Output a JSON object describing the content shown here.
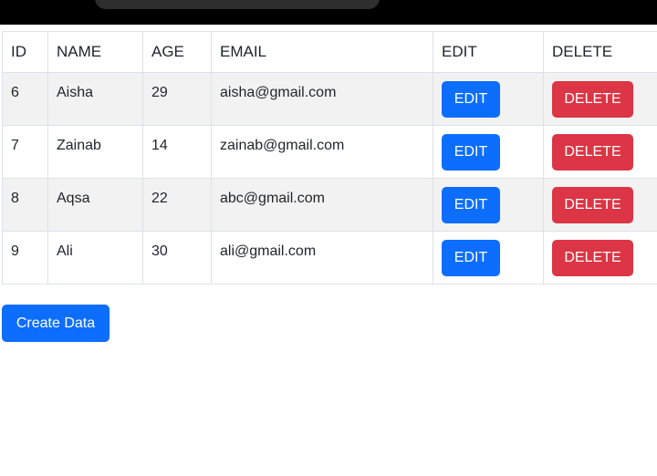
{
  "table": {
    "headers": [
      "ID",
      "NAME",
      "AGE",
      "EMAIL",
      "EDIT",
      "DELETE"
    ],
    "rows": [
      {
        "id": "6",
        "name": "Aisha",
        "age": "29",
        "email": "aisha@gmail.com",
        "edit_label": "EDIT",
        "delete_label": "DELETE"
      },
      {
        "id": "7",
        "name": "Zainab",
        "age": "14",
        "email": "zainab@gmail.com",
        "edit_label": "EDIT",
        "delete_label": "DELETE"
      },
      {
        "id": "8",
        "name": "Aqsa",
        "age": "22",
        "email": "abc@gmail.com",
        "edit_label": "EDIT",
        "delete_label": "DELETE"
      },
      {
        "id": "9",
        "name": "Ali",
        "age": "30",
        "email": "ali@gmail.com",
        "edit_label": "EDIT",
        "delete_label": "DELETE"
      }
    ]
  },
  "actions": {
    "create_label": "Create Data"
  },
  "colors": {
    "primary": "#0d6efd",
    "danger": "#dc3545",
    "stripe": "#f2f2f2",
    "top_bar": "#000000"
  }
}
